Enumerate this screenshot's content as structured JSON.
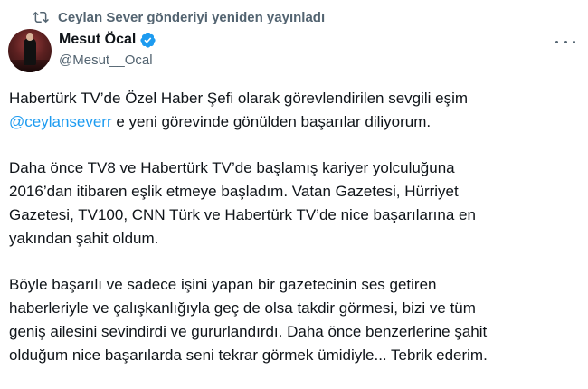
{
  "repost": {
    "text": "Ceylan Sever gönderiyi yeniden yayınladı",
    "icon": "repost-icon"
  },
  "author": {
    "name": "Mesut Öcal",
    "handle": "@Mesut__Ocal",
    "verified": true,
    "verified_color": "#1d9bf0"
  },
  "tweet": {
    "p1_line1": "Habertürk TV’de Özel Haber Şefi olarak görevlendirilen sevgili eşim",
    "p1_mention": "@ceylanseverr",
    "p1_line2_rest": " e yeni görevinde gönülden başarılar diliyorum.",
    "p2_line1": "Daha önce TV8 ve Habertürk TV’de başlamış kariyer yolculuğuna",
    "p2_line2": "2016’dan itibaren eşlik etmeye başladım. Vatan Gazetesi, Hürriyet",
    "p2_line3": "Gazetesi, TV100, CNN Türk ve Habertürk TV’de nice başarılarına en",
    "p2_line4": "yakından şahit oldum.",
    "p3_line1": "Böyle başarılı ve sadece işini yapan bir gazetecinin ses getiren",
    "p3_line2": "haberleriyle ve çalışkanlığıyla geç de olsa takdir görmesi, bizi ve tüm",
    "p3_line3": "geniş ailesini sevindirdi ve gururlandırdı. Daha önce benzerlerine şahit",
    "p3_line4": "olduğum nice başarılarda seni tekrar görmek ümidiyle... Tebrik ederim."
  },
  "colors": {
    "text": "#0f1419",
    "secondary": "#536471",
    "link": "#1d9bf0"
  }
}
